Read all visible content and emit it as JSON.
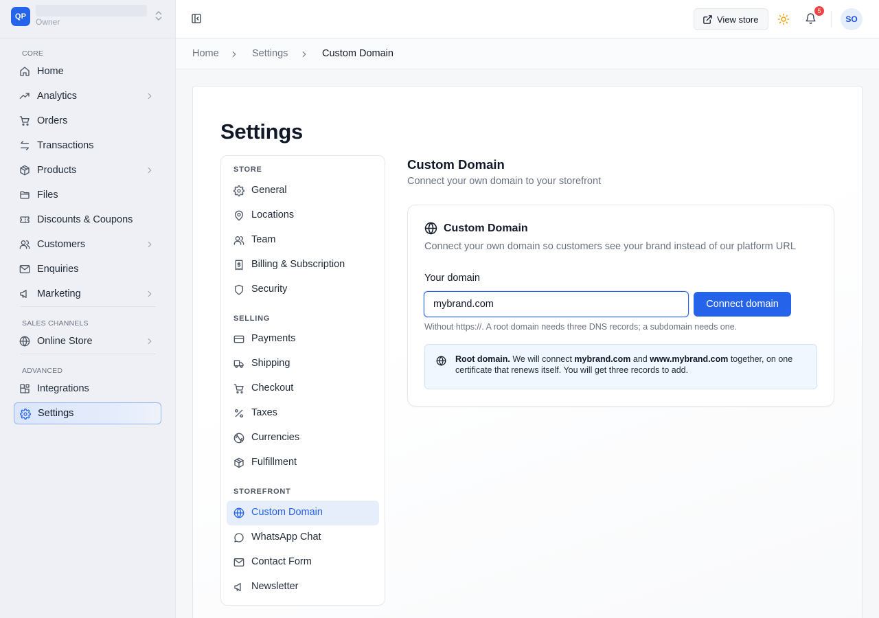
{
  "workspace": {
    "logo_initials": "QP",
    "name": "",
    "role": "Owner"
  },
  "sidebar": {
    "groups": [
      {
        "label": "CORE"
      },
      {
        "label": "SALES CHANNELS"
      },
      {
        "label": "ADVANCED"
      }
    ],
    "items": [
      {
        "label": "Home",
        "icon": "home-icon"
      },
      {
        "label": "Analytics",
        "icon": "trending-up-icon"
      },
      {
        "label": "Orders",
        "icon": "cart-icon"
      },
      {
        "label": "Transactions",
        "icon": "arrows-swap-icon"
      },
      {
        "label": "Products",
        "icon": "package-icon"
      },
      {
        "label": "Files",
        "icon": "folder-icon"
      },
      {
        "label": "Discounts & Coupons",
        "icon": "ticket-icon"
      },
      {
        "label": "Customers",
        "icon": "users-icon"
      },
      {
        "label": "Enquiries",
        "icon": "mail-icon"
      },
      {
        "label": "Marketing",
        "icon": "megaphone-icon"
      },
      {
        "label": "Online Store",
        "icon": "globe-icon"
      },
      {
        "label": "Integrations",
        "icon": "blocks-icon"
      },
      {
        "label": "Settings",
        "icon": "gear-icon",
        "active": true
      }
    ]
  },
  "topbar": {
    "view_store_label": "View store",
    "notification_count": "5",
    "avatar_initials": "SO"
  },
  "breadcrumb": [
    "Home",
    "Settings",
    "Custom Domain"
  ],
  "page": {
    "title": "Settings"
  },
  "settings_nav": {
    "groups": [
      {
        "label": "STORE"
      },
      {
        "label": "SELLING"
      },
      {
        "label": "STOREFRONT"
      }
    ],
    "items": [
      {
        "label": "General",
        "icon": "gear-icon"
      },
      {
        "label": "Locations",
        "icon": "map-pin-icon"
      },
      {
        "label": "Team",
        "icon": "users-icon"
      },
      {
        "label": "Billing & Subscription",
        "icon": "receipt-icon"
      },
      {
        "label": "Security",
        "icon": "shield-icon"
      },
      {
        "label": "Payments",
        "icon": "credit-card-icon"
      },
      {
        "label": "Shipping",
        "icon": "truck-icon"
      },
      {
        "label": "Checkout",
        "icon": "cart-icon"
      },
      {
        "label": "Taxes",
        "icon": "percent-icon"
      },
      {
        "label": "Currencies",
        "icon": "coins-icon"
      },
      {
        "label": "Fulfillment",
        "icon": "package-icon"
      },
      {
        "label": "Custom Domain",
        "icon": "globe-icon",
        "active": true
      },
      {
        "label": "WhatsApp Chat",
        "icon": "chat-bubble-icon"
      },
      {
        "label": "Contact Form",
        "icon": "mail-icon"
      },
      {
        "label": "Newsletter",
        "icon": "megaphone-icon"
      }
    ]
  },
  "content": {
    "title": "Custom Domain",
    "subtitle": "Connect your own domain to your storefront",
    "card": {
      "title": "Custom Domain",
      "description": "Connect your own domain so customers see your brand instead of our platform URL",
      "field_label": "Your domain",
      "input_value": "mybrand.com",
      "button_label": "Connect domain",
      "hint": "Without https://. A root domain needs three DNS records; a subdomain needs one.",
      "info": {
        "lead": "Root domain.",
        "t1": " We will connect ",
        "d1": "mybrand.com",
        "t2": " and ",
        "d2": "www.mybrand.com",
        "t3": " together, on one certificate that renews itself. You will get three records to add."
      }
    }
  },
  "colors": {
    "accent": "#2563eb",
    "badge": "#ef4444",
    "sun": "#f59e0b"
  }
}
